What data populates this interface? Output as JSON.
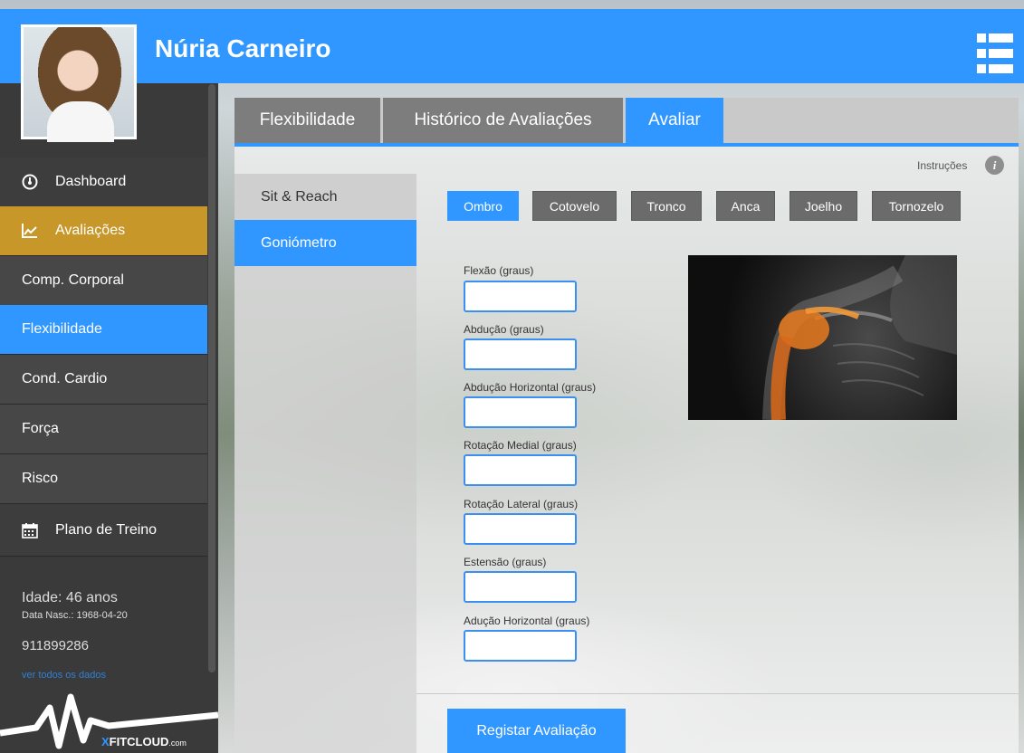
{
  "header": {
    "name": "Núria Carneiro"
  },
  "sidebar": {
    "items": [
      {
        "label": "Dashboard",
        "icon": "speedometer-icon"
      },
      {
        "label": "Avaliações",
        "icon": "line-chart-icon"
      },
      {
        "label": "Comp. Corporal"
      },
      {
        "label": "Flexibilidade"
      },
      {
        "label": "Cond. Cardio"
      },
      {
        "label": "Força"
      },
      {
        "label": "Risco"
      },
      {
        "label": "Plano de Treino",
        "icon": "calendar-icon"
      }
    ],
    "active_item": "Flexibilidade",
    "highlight_item": "Avaliações",
    "info": {
      "age": "Idade: 46 anos",
      "birth": "Data Nasc.: 1968-04-20",
      "phone": "911899286",
      "link": "ver todos os dados"
    },
    "brand": {
      "x": "X",
      "name": "FITCLOUD",
      "suffix": ".com"
    }
  },
  "tabs": [
    {
      "label": "Flexibilidade"
    },
    {
      "label": "Histórico de Avaliações"
    },
    {
      "label": "Avaliar"
    }
  ],
  "active_tab": "Avaliar",
  "subnav": [
    {
      "label": "Sit & Reach"
    },
    {
      "label": "Goniómetro"
    }
  ],
  "active_subnav": "Goniómetro",
  "instructions": {
    "label": "Instruções",
    "icon": "info-icon",
    "glyph": "i"
  },
  "joints": [
    {
      "label": "Ombro"
    },
    {
      "label": "Cotovelo"
    },
    {
      "label": "Tronco"
    },
    {
      "label": "Anca"
    },
    {
      "label": "Joelho"
    },
    {
      "label": "Tornozelo"
    }
  ],
  "active_joint": "Ombro",
  "fields": [
    {
      "label": "Flexão (graus)",
      "value": ""
    },
    {
      "label": "Abdução (graus)",
      "value": ""
    },
    {
      "label": "Abdução Horizontal (graus)",
      "value": ""
    },
    {
      "label": "Rotação Medial (graus)",
      "value": ""
    },
    {
      "label": "Rotação Lateral (graus)",
      "value": ""
    },
    {
      "label": "Estensão (graus)",
      "value": ""
    },
    {
      "label": "Adução Horizontal (graus)",
      "value": ""
    }
  ],
  "submit": {
    "label": "Registar Avaliação"
  },
  "colors": {
    "accent": "#2f97ff",
    "highlight": "#c8972a",
    "sidebar": "#3a3a3a"
  }
}
